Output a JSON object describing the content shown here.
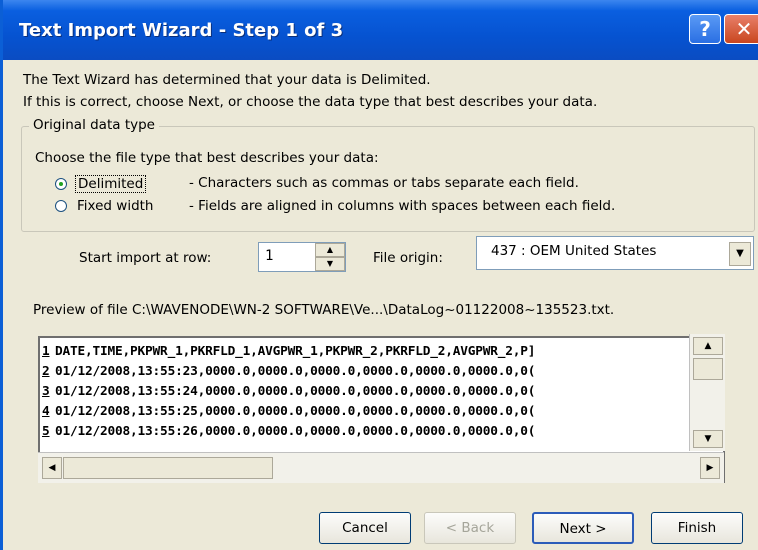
{
  "window": {
    "title": "Text Import Wizard - Step 1 of 3",
    "help_glyph": "?",
    "close_glyph": "✕"
  },
  "intro": {
    "line1": "The Text Wizard has determined that your data is Delimited.",
    "line2": "If this is correct, choose Next, or choose the data type that best describes your data."
  },
  "original_data_type": {
    "legend": "Original data type",
    "prompt": "Choose the file type that best describes your data:",
    "options": [
      {
        "label": "Delimited",
        "description": "- Characters such as commas or tabs separate each field.",
        "selected": true
      },
      {
        "label": "Fixed width",
        "description": "- Fields are aligned in columns with spaces between each field.",
        "selected": false
      }
    ]
  },
  "import_options": {
    "start_row_label": "Start import at row:",
    "start_row_value": "1",
    "file_origin_label": "File origin:",
    "file_origin_value": "437 : OEM United States"
  },
  "preview": {
    "label": "Preview of file C:\\WAVENODE\\WN-2 SOFTWARE\\Ve...\\DataLog~01122008~135523.txt.",
    "lines": [
      {
        "num": "1",
        "text": "DATE,TIME,PKPWR_1,PKRFLD_1,AVGPWR_1,PKPWR_2,PKRFLD_2,AVGPWR_2,P]"
      },
      {
        "num": "2",
        "text": "01/12/2008,13:55:23,0000.0,0000.0,0000.0,0000.0,0000.0,0000.0,0("
      },
      {
        "num": "3",
        "text": "01/12/2008,13:55:24,0000.0,0000.0,0000.0,0000.0,0000.0,0000.0,0("
      },
      {
        "num": "4",
        "text": "01/12/2008,13:55:25,0000.0,0000.0,0000.0,0000.0,0000.0,0000.0,0("
      },
      {
        "num": "5",
        "text": "01/12/2008,13:55:26,0000.0,0000.0,0000.0,0000.0,0000.0,0000.0,0("
      }
    ]
  },
  "buttons": {
    "cancel": "Cancel",
    "back": "< Back",
    "next": "Next >",
    "finish": "Finish"
  },
  "glyphs": {
    "up": "▲",
    "down": "▼",
    "left": "◀",
    "right": "▶"
  }
}
